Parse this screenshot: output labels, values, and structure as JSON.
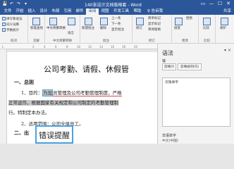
{
  "window": {
    "title": "140张设计文档版格套 - Word",
    "controls": [
      "▭",
      "—",
      "☐",
      "✕"
    ]
  },
  "qat": [
    "💾",
    "↶",
    "↷",
    "▾"
  ],
  "tabs": [
    "文件",
    "开始",
    "插入",
    "设计",
    "布局",
    "引用",
    "邮件",
    "审阅",
    "视图",
    "开发工具",
    "帮助",
    "♀ 告诉我",
    "共享"
  ],
  "active_tab": "审阅",
  "ribbon": {
    "proofing": {
      "items": [
        "拼写和语法",
        "同义词库",
        "字数统计"
      ],
      "label": "校对"
    },
    "insights": {
      "item": "智能查找",
      "label": "见解"
    },
    "language": {
      "items": [
        "中文简繁转换",
        "语言"
      ],
      "label": "中文简繁转换"
    },
    "comments": {
      "items": [
        "新建批注",
        "删除",
        "上一条",
        "下一条",
        "显示批注"
      ],
      "label": "批注"
    },
    "tracking": {
      "items": [
        "修订",
        "简单标记",
        "显示标记",
        "审阅窗格"
      ],
      "label": "修订"
    },
    "changes": {
      "items": [
        "接受",
        "拒绝"
      ],
      "label": "更改"
    },
    "compare": {
      "item": "比较",
      "label": "比较"
    },
    "protect": {
      "item": "保护",
      "label": ""
    }
  },
  "ruler": {
    "ticks": [
      "L",
      "2",
      "4",
      "6",
      "8",
      "10",
      "12",
      "14",
      "16",
      "18",
      "20"
    ]
  },
  "document": {
    "heading": "公司考勤、请假、休假管",
    "section1": "一、总则",
    "line1_a": "1、目的：",
    "line1_err": "为加",
    "line1_b": "员管理及公司考勤管理制度，严格",
    "line2": "正常运作，根据国家有关规定和公司制定的考勤管理制",
    "line3": "行。特制定本办法。",
    "line4": "2、适用范围：公司全体员工。",
    "section2": "二、出"
  },
  "popup": {
    "text": "错误提醒"
  },
  "grammar_pane": {
    "title": "语法",
    "controls": "▾ ×",
    "subtitle": "输",
    "buttons": [
      "忽略(I)",
      "忽略规则(G)"
    ],
    "box_label": "仅限单字",
    "footer": "非语单字",
    "footer2": "中文(中国)"
  }
}
